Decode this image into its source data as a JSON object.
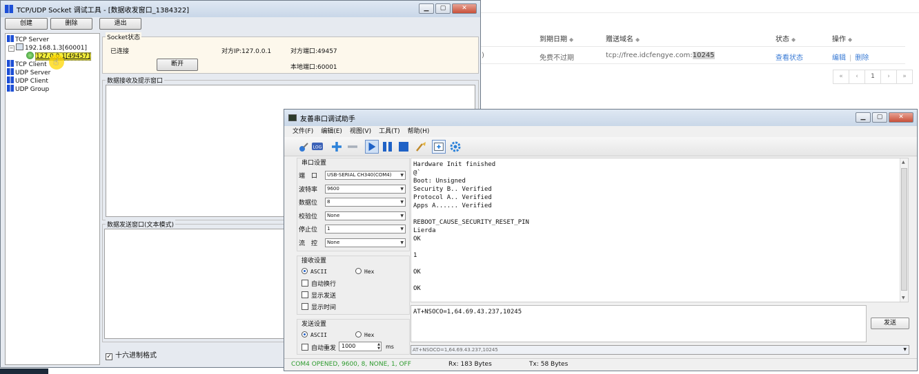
{
  "web": {
    "columns": [
      "到期日期",
      "赠送域名",
      "状态",
      "操作"
    ],
    "row": {
      "expire": "免费不过期",
      "domain_prefix": "tcp://free.idcfengye.com:",
      "domain_port": "10245",
      "status_link": "查看状态",
      "edit_link": "编辑",
      "separator": "|",
      "delete_link": "删除",
      "partial": ")"
    },
    "pager": [
      "«",
      "‹",
      "1",
      "›",
      "»"
    ]
  },
  "tcp": {
    "title": "TCP/UDP Socket 调试工具 - [数据收发窗口_1384322]",
    "buttons": {
      "create": "创建",
      "delete": "删除",
      "exit": "退出"
    },
    "tree": {
      "tcp_server": "TCP Server",
      "server_node": "192.168.1.3[60001]",
      "client_node": "127.0.0.1[49457]",
      "tcp_client": "TCP Client",
      "udp_server": "UDP Server",
      "udp_client": "UDP Client",
      "udp_group": "UDP Group"
    },
    "socket": {
      "group_label": "Socket状态",
      "state": "已连接",
      "peer_ip": "对方IP:127.0.0.1",
      "peer_port": "对方端口:49457",
      "local_port": "本地端口:60001",
      "disconnect": "断开"
    },
    "recv_label": "数据接收及提示窗口",
    "send_label": "数据发送窗口(文本模式)",
    "hex_label": "十六进制格式",
    "hex_checked": "✓"
  },
  "serial": {
    "title": "友善串口调试助手",
    "menu": [
      "文件(F)",
      "编辑(E)",
      "视图(V)",
      "工具(T)",
      "帮助(H)"
    ],
    "port_section": "串口设置",
    "fields": [
      {
        "label": "端　口",
        "value": "USB-SERIAL CH340(COM4)"
      },
      {
        "label": "波特率",
        "value": "9600"
      },
      {
        "label": "数据位",
        "value": "8"
      },
      {
        "label": "校验位",
        "value": "None"
      },
      {
        "label": "停止位",
        "value": "1"
      },
      {
        "label": "流　控",
        "value": "None"
      }
    ],
    "recv_section": "接收设置",
    "recv_ascii": "ASCII",
    "recv_hex": "Hex",
    "recv_opts": [
      "自动换行",
      "显示发送",
      "显示时间"
    ],
    "send_section": "发送设置",
    "send_ascii": "ASCII",
    "send_hex": "Hex",
    "auto_resend": "自动重发",
    "interval": "1000",
    "interval_unit": "ms",
    "terminal": "Hardware Init finished\n@`\nBoot: Unsigned\nSecurity B.. Verified\nProtocol A.. Verified\nApps A...... Verified\n\nREBOOT_CAUSE_SECURITY_RESET_PIN\nLierda\nOK\n\n1\n\nOK\n\nOK",
    "input_text": "AT+NSOCO=1,64.69.43.237,10245",
    "send_button": "发送",
    "history": "AT+NSOCO=1,64.69.43.237,10245",
    "status_port": "COM4 OPENED, 9600, 8, NONE, 1, OFF",
    "status_rx": "Rx: 183 Bytes",
    "status_tx": "Tx: 58 Bytes",
    "status_color": "#2e9b2e"
  }
}
